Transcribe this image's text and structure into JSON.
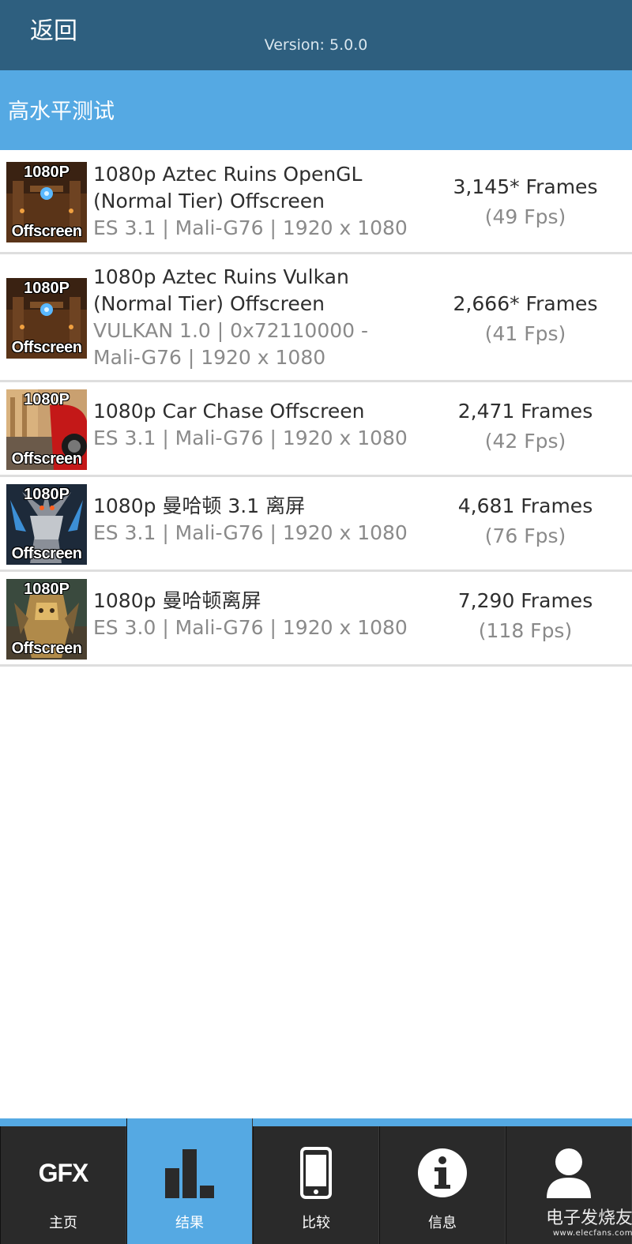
{
  "header": {
    "back_label": "返回",
    "version": "Version: 5.0.0"
  },
  "section": {
    "title": "高水平测试"
  },
  "thumb_labels": {
    "top": "1080P",
    "bottom": "Offscreen"
  },
  "results": [
    {
      "name": "1080p Aztec Ruins OpenGL (Normal Tier) Offscreen",
      "detail": "ES 3.1 | Mali-G76 | 1920 x 1080",
      "frames": "3,145* Frames",
      "fps": "(49 Fps)",
      "thumbnail": "aztec-ruins-thumbnail"
    },
    {
      "name": "1080p Aztec Ruins Vulkan (Normal Tier) Offscreen",
      "detail": "VULKAN 1.0 | 0x72110000 - Mali-G76 | 1920 x 1080",
      "frames": "2,666* Frames",
      "fps": "(41 Fps)",
      "thumbnail": "aztec-ruins-thumbnail"
    },
    {
      "name": "1080p Car Chase Offscreen",
      "detail": "ES 3.1 | Mali-G76 | 1920 x 1080",
      "frames": "2,471 Frames",
      "fps": "(42 Fps)",
      "thumbnail": "car-chase-thumbnail"
    },
    {
      "name": "1080p 曼哈顿 3.1 离屏",
      "detail": "ES 3.1 | Mali-G76 | 1920 x 1080",
      "frames": "4,681 Frames",
      "fps": "(76 Fps)",
      "thumbnail": "manhattan-31-thumbnail"
    },
    {
      "name": "1080p 曼哈顿离屏",
      "detail": "ES 3.0 | Mali-G76 | 1920 x 1080",
      "frames": "7,290 Frames",
      "fps": "(118 Fps)",
      "thumbnail": "manhattan-thumbnail"
    }
  ],
  "nav": {
    "items": [
      {
        "label": "主页",
        "icon": "gfx-logo-icon",
        "active": false,
        "icon_text": "GFX"
      },
      {
        "label": "结果",
        "icon": "bar-chart-icon",
        "active": true
      },
      {
        "label": "比较",
        "icon": "phone-icon",
        "active": false
      },
      {
        "label": "信息",
        "icon": "info-icon",
        "active": false
      },
      {
        "label": "",
        "icon": "user-icon",
        "active": false
      }
    ]
  },
  "watermark": {
    "main": "电子发烧友",
    "sub": "www.elecfans.com"
  },
  "colors": {
    "topbar": "#2e5f7f",
    "accent": "#55a9e3",
    "nav_bg": "#2a2a2a",
    "text_primary": "#2e2e2e",
    "text_secondary": "#8a8a8a"
  }
}
